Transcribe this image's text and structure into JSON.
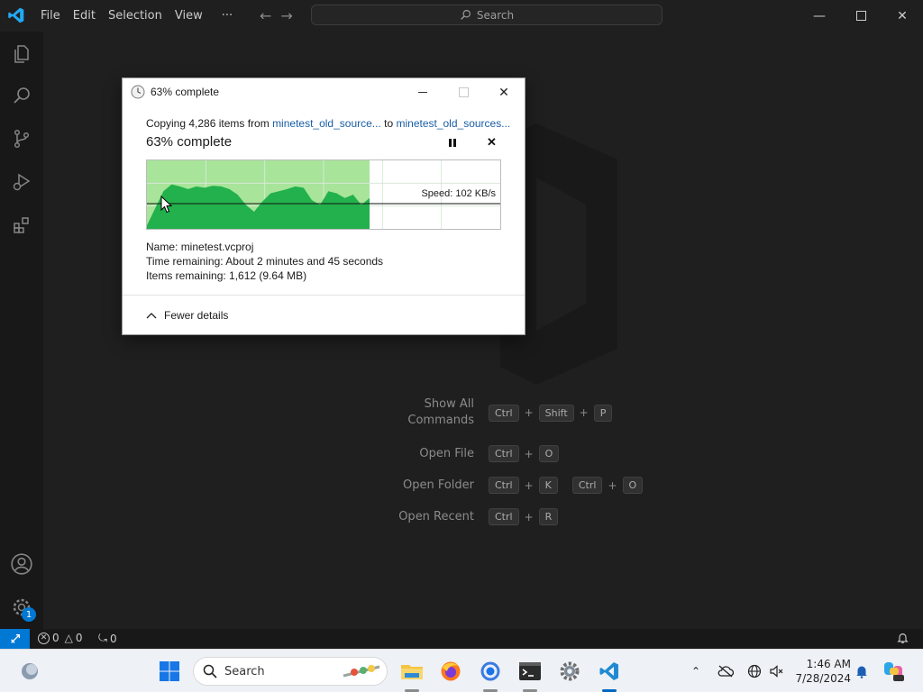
{
  "titlebar": {
    "menu": [
      "File",
      "Edit",
      "Selection",
      "View",
      "···"
    ],
    "search_placeholder": "Search"
  },
  "welcome_shortcuts": [
    {
      "label": "Show All Commands",
      "keys": [
        [
          "Ctrl",
          "Shift",
          "P"
        ]
      ]
    },
    {
      "label": "Open File",
      "keys": [
        [
          "Ctrl",
          "O"
        ]
      ]
    },
    {
      "label": "Open Folder",
      "keys": [
        [
          "Ctrl",
          "K"
        ],
        [
          "Ctrl",
          "O"
        ]
      ]
    },
    {
      "label": "Open Recent",
      "keys": [
        [
          "Ctrl",
          "R"
        ]
      ]
    }
  ],
  "activitybar": {
    "icons": [
      "files-icon",
      "search-icon",
      "source-control-icon",
      "run-debug-icon",
      "extensions-icon",
      "account-icon",
      "manage-gear-icon"
    ],
    "manage_badge": "1"
  },
  "statusbar": {
    "errors": "0",
    "warnings": "0",
    "ports": "0"
  },
  "copy_dialog": {
    "title": "63% complete",
    "copy_prefix": "Copying 4,286 items from ",
    "source": "minetest_old_source...",
    "to_word": " to ",
    "destination": "minetest_old_sources...",
    "progress_heading": "63% complete",
    "progress": 0.63,
    "speed": "Speed: 102 KB/s",
    "name_label": "Name:",
    "name_value": "minetest.vcproj",
    "time_label": "Time remaining:",
    "time_value": "About 2 minutes and 45 seconds",
    "items_label": "Items remaining:",
    "items_value": "1,612 (9.64 MB)",
    "fewer_details": "Fewer details"
  },
  "taskbar": {
    "search_placeholder": "Search",
    "apps": [
      "file-explorer-icon",
      "firefox-icon",
      "chrome-icon",
      "terminal-icon",
      "settings-icon",
      "vscode-icon"
    ],
    "time": "1:46 AM",
    "date": "7/28/2024"
  },
  "colors": {
    "accent": "#0078d4",
    "graph_fill": "#22b14c",
    "graph_area": "#a8e49a"
  }
}
